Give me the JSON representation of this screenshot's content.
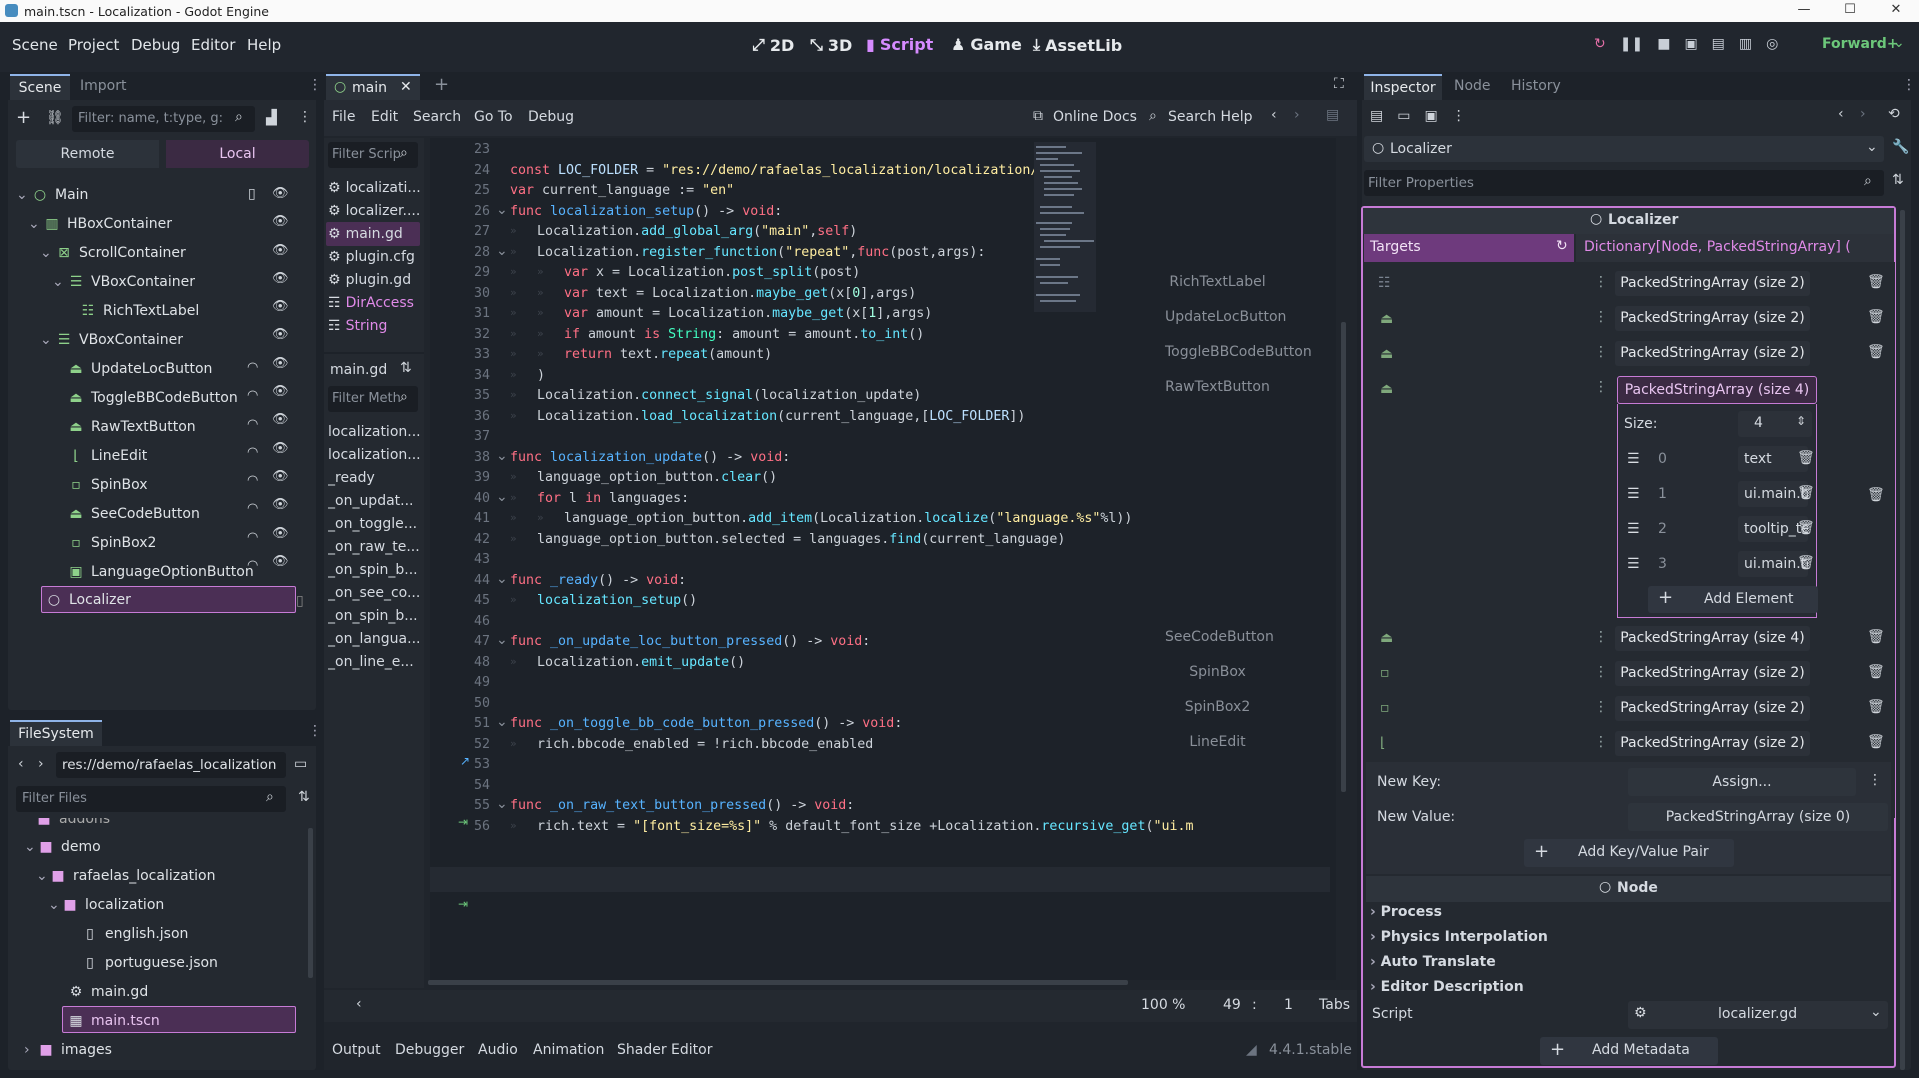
{
  "title": "main.tscn - Localization - Godot Engine",
  "menu": [
    "Scene",
    "Project",
    "Debug",
    "Editor",
    "Help"
  ],
  "workspaces": [
    "2D",
    "3D",
    "Script",
    "Game",
    "AssetLib"
  ],
  "renderer": "Forward+",
  "scene_dock": {
    "tabs": [
      "Scene",
      "Import"
    ],
    "filter": "Filter: name, t:type, g:",
    "remote": "Remote",
    "local": "Local",
    "tree": [
      "Main",
      "HBoxContainer",
      "ScrollContainer",
      "VBoxContainer",
      "RichTextLabel",
      "VBoxContainer",
      "UpdateLocButton",
      "ToggleBBCodeButton",
      "RawTextButton",
      "LineEdit",
      "SpinBox",
      "SeeCodeButton",
      "SpinBox2",
      "LanguageOptionButton",
      "Localizer"
    ]
  },
  "filesystem": {
    "tab": "FileSystem",
    "path": "res://demo/rafaelas_localization",
    "filter": "Filter Files",
    "items": [
      "addons",
      "demo",
      "rafaelas_localization",
      "localization",
      "english.json",
      "portuguese.json",
      "main.gd",
      "main.tscn",
      "images"
    ]
  },
  "script_editor": {
    "tab": "main",
    "menu": [
      "File",
      "Edit",
      "Search",
      "Go To",
      "Debug"
    ],
    "online_docs": "Online Docs",
    "search_help": "Search Help",
    "filter_scripts": "Filter Scrip",
    "scripts": [
      "localizati...",
      "localizer....",
      "main.gd",
      "plugin.cfg",
      "plugin.gd",
      "DirAccess",
      "String"
    ],
    "current": "main.gd",
    "filter_methods": "Filter Meth",
    "methods": [
      "localization...",
      "localization...",
      "_ready",
      "_on_updat...",
      "_on_toggle...",
      "_on_raw_te...",
      "_on_spin_b...",
      "_on_see_co...",
      "_on_spin_b...",
      "_on_langua...",
      "_on_line_e..."
    ],
    "zoom": "100 %",
    "line": "49",
    "col": "1",
    "indent": "Tabs"
  },
  "bottom": {
    "tabs": [
      "Output",
      "Debugger",
      "Audio",
      "Animation",
      "Shader Editor"
    ],
    "version": "4.4.1.stable"
  },
  "inspector": {
    "tabs": [
      "Inspector",
      "Node",
      "History"
    ],
    "object": "Localizer",
    "filter": "Filter Properties",
    "section": "Localizer",
    "targets_label": "Targets",
    "targets_type": "Dictionary[Node, PackedStringArray] (",
    "entries": [
      {
        "key": "RichTextLabel",
        "value": "PackedStringArray (size 2)"
      },
      {
        "key": "UpdateLocButton",
        "value": "PackedStringArray (size 2)"
      },
      {
        "key": "ToggleBBCodeButton",
        "value": "PackedStringArray (size 2)"
      },
      {
        "key": "RawTextButton",
        "value": "PackedStringArray (size 4)"
      },
      {
        "key": "SeeCodeButton",
        "value": "PackedStringArray (size 4)"
      },
      {
        "key": "SpinBox",
        "value": "PackedStringArray (size 2)"
      },
      {
        "key": "SpinBox2",
        "value": "PackedStringArray (size 2)"
      },
      {
        "key": "LineEdit",
        "value": "PackedStringArray (size 2)"
      }
    ],
    "size_label": "Size:",
    "size_value": "4",
    "elements": [
      {
        "i": "0",
        "v": "text"
      },
      {
        "i": "1",
        "v": "ui.main.bu"
      },
      {
        "i": "2",
        "v": "tooltip_tex"
      },
      {
        "i": "3",
        "v": "ui.main.to"
      }
    ],
    "add_element": "Add Element",
    "new_key": "New Key:",
    "assign": "Assign...",
    "new_value": "New Value:",
    "new_value_type": "PackedStringArray (size 0)",
    "add_kv": "Add Key/Value Pair",
    "node_section": "Node",
    "groups": [
      "Process",
      "Physics Interpolation",
      "Auto Translate",
      "Editor Description"
    ],
    "script_label": "Script",
    "script_value": "localizer.gd",
    "add_metadata": "Add Metadata"
  },
  "colors": {
    "accent": "#c77bd6",
    "selection": "#4b2f55",
    "keyword": "#ff7085",
    "function": "#57b3ff",
    "string": "#ffeda1"
  }
}
